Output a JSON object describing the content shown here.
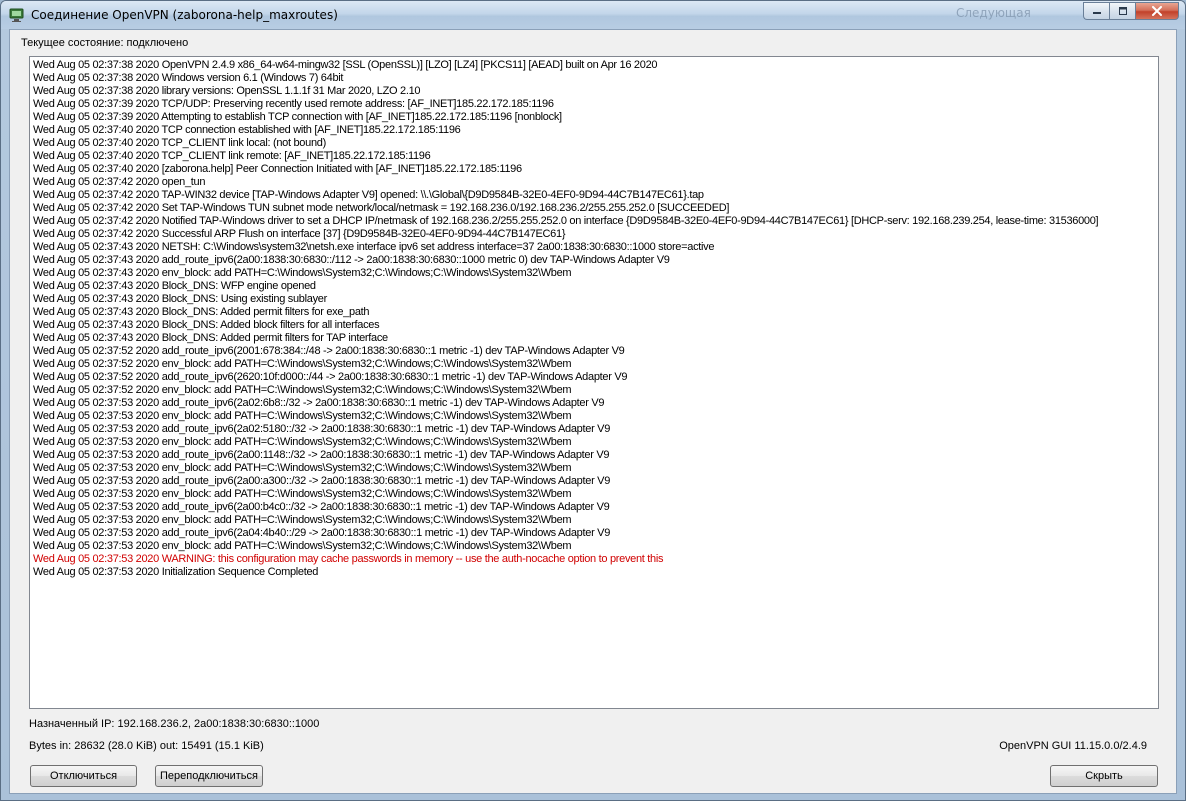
{
  "window": {
    "title": "Соединение OpenVPN (zaborona-help_maxroutes)",
    "background_text": "Следующая"
  },
  "status": {
    "label": "Текущее состояние: подключено"
  },
  "log": [
    {
      "text": "Wed Aug 05 02:37:38 2020 OpenVPN 2.4.9 x86_64-w64-mingw32 [SSL (OpenSSL)] [LZO] [LZ4] [PKCS11] [AEAD] built on Apr 16 2020",
      "warning": false
    },
    {
      "text": "Wed Aug 05 02:37:38 2020 Windows version 6.1 (Windows 7) 64bit",
      "warning": false
    },
    {
      "text": "Wed Aug 05 02:37:38 2020 library versions: OpenSSL 1.1.1f  31 Mar 2020, LZO 2.10",
      "warning": false
    },
    {
      "text": "Wed Aug 05 02:37:39 2020 TCP/UDP: Preserving recently used remote address: [AF_INET]185.22.172.185:1196",
      "warning": false
    },
    {
      "text": "Wed Aug 05 02:37:39 2020 Attempting to establish TCP connection with [AF_INET]185.22.172.185:1196 [nonblock]",
      "warning": false
    },
    {
      "text": "Wed Aug 05 02:37:40 2020 TCP connection established with [AF_INET]185.22.172.185:1196",
      "warning": false
    },
    {
      "text": "Wed Aug 05 02:37:40 2020 TCP_CLIENT link local: (not bound)",
      "warning": false
    },
    {
      "text": "Wed Aug 05 02:37:40 2020 TCP_CLIENT link remote: [AF_INET]185.22.172.185:1196",
      "warning": false
    },
    {
      "text": "Wed Aug 05 02:37:40 2020 [zaborona.help] Peer Connection Initiated with [AF_INET]185.22.172.185:1196",
      "warning": false
    },
    {
      "text": "Wed Aug 05 02:37:42 2020 open_tun",
      "warning": false
    },
    {
      "text": "Wed Aug 05 02:37:42 2020 TAP-WIN32 device [TAP-Windows Adapter V9] opened: \\\\.\\Global\\{D9D9584B-32E0-4EF0-9D94-44C7B147EC61}.tap",
      "warning": false
    },
    {
      "text": "Wed Aug 05 02:37:42 2020 Set TAP-Windows TUN subnet mode network/local/netmask = 192.168.236.0/192.168.236.2/255.255.252.0 [SUCCEEDED]",
      "warning": false
    },
    {
      "text": "Wed Aug 05 02:37:42 2020 Notified TAP-Windows driver to set a DHCP IP/netmask of 192.168.236.2/255.255.252.0 on interface {D9D9584B-32E0-4EF0-9D94-44C7B147EC61} [DHCP-serv: 192.168.239.254, lease-time: 31536000]",
      "warning": false
    },
    {
      "text": "Wed Aug 05 02:37:42 2020 Successful ARP Flush on interface [37] {D9D9584B-32E0-4EF0-9D94-44C7B147EC61}",
      "warning": false
    },
    {
      "text": "Wed Aug 05 02:37:43 2020 NETSH: C:\\Windows\\system32\\netsh.exe interface ipv6 set address interface=37 2a00:1838:30:6830::1000 store=active",
      "warning": false
    },
    {
      "text": "Wed Aug 05 02:37:43 2020 add_route_ipv6(2a00:1838:30:6830::/112 -> 2a00:1838:30:6830::1000 metric 0) dev TAP-Windows Adapter V9",
      "warning": false
    },
    {
      "text": "Wed Aug 05 02:37:43 2020 env_block: add PATH=C:\\Windows\\System32;C:\\Windows;C:\\Windows\\System32\\Wbem",
      "warning": false
    },
    {
      "text": "Wed Aug 05 02:37:43 2020 Block_DNS: WFP engine opened",
      "warning": false
    },
    {
      "text": "Wed Aug 05 02:37:43 2020 Block_DNS: Using existing sublayer",
      "warning": false
    },
    {
      "text": "Wed Aug 05 02:37:43 2020 Block_DNS: Added permit filters for exe_path",
      "warning": false
    },
    {
      "text": "Wed Aug 05 02:37:43 2020 Block_DNS: Added block filters for all interfaces",
      "warning": false
    },
    {
      "text": "Wed Aug 05 02:37:43 2020 Block_DNS: Added permit filters for TAP interface",
      "warning": false
    },
    {
      "text": "Wed Aug 05 02:37:52 2020 add_route_ipv6(2001:678:384::/48 -> 2a00:1838:30:6830::1 metric -1) dev TAP-Windows Adapter V9",
      "warning": false
    },
    {
      "text": "Wed Aug 05 02:37:52 2020 env_block: add PATH=C:\\Windows\\System32;C:\\Windows;C:\\Windows\\System32\\Wbem",
      "warning": false
    },
    {
      "text": "Wed Aug 05 02:37:52 2020 add_route_ipv6(2620:10f:d000::/44 -> 2a00:1838:30:6830::1 metric -1) dev TAP-Windows Adapter V9",
      "warning": false
    },
    {
      "text": "Wed Aug 05 02:37:52 2020 env_block: add PATH=C:\\Windows\\System32;C:\\Windows;C:\\Windows\\System32\\Wbem",
      "warning": false
    },
    {
      "text": "Wed Aug 05 02:37:53 2020 add_route_ipv6(2a02:6b8::/32 -> 2a00:1838:30:6830::1 metric -1) dev TAP-Windows Adapter V9",
      "warning": false
    },
    {
      "text": "Wed Aug 05 02:37:53 2020 env_block: add PATH=C:\\Windows\\System32;C:\\Windows;C:\\Windows\\System32\\Wbem",
      "warning": false
    },
    {
      "text": "Wed Aug 05 02:37:53 2020 add_route_ipv6(2a02:5180::/32 -> 2a00:1838:30:6830::1 metric -1) dev TAP-Windows Adapter V9",
      "warning": false
    },
    {
      "text": "Wed Aug 05 02:37:53 2020 env_block: add PATH=C:\\Windows\\System32;C:\\Windows;C:\\Windows\\System32\\Wbem",
      "warning": false
    },
    {
      "text": "Wed Aug 05 02:37:53 2020 add_route_ipv6(2a00:1148::/32 -> 2a00:1838:30:6830::1 metric -1) dev TAP-Windows Adapter V9",
      "warning": false
    },
    {
      "text": "Wed Aug 05 02:37:53 2020 env_block: add PATH=C:\\Windows\\System32;C:\\Windows;C:\\Windows\\System32\\Wbem",
      "warning": false
    },
    {
      "text": "Wed Aug 05 02:37:53 2020 add_route_ipv6(2a00:a300::/32 -> 2a00:1838:30:6830::1 metric -1) dev TAP-Windows Adapter V9",
      "warning": false
    },
    {
      "text": "Wed Aug 05 02:37:53 2020 env_block: add PATH=C:\\Windows\\System32;C:\\Windows;C:\\Windows\\System32\\Wbem",
      "warning": false
    },
    {
      "text": "Wed Aug 05 02:37:53 2020 add_route_ipv6(2a00:b4c0::/32 -> 2a00:1838:30:6830::1 metric -1) dev TAP-Windows Adapter V9",
      "warning": false
    },
    {
      "text": "Wed Aug 05 02:37:53 2020 env_block: add PATH=C:\\Windows\\System32;C:\\Windows;C:\\Windows\\System32\\Wbem",
      "warning": false
    },
    {
      "text": "Wed Aug 05 02:37:53 2020 add_route_ipv6(2a04:4b40::/29 -> 2a00:1838:30:6830::1 metric -1) dev TAP-Windows Adapter V9",
      "warning": false
    },
    {
      "text": "Wed Aug 05 02:37:53 2020 env_block: add PATH=C:\\Windows\\System32;C:\\Windows;C:\\Windows\\System32\\Wbem",
      "warning": false
    },
    {
      "text": "Wed Aug 05 02:37:53 2020 WARNING: this configuration may cache passwords in memory -- use the auth-nocache option to prevent this",
      "warning": true
    },
    {
      "text": "Wed Aug 05 02:37:53 2020 Initialization Sequence Completed",
      "warning": false
    }
  ],
  "info": {
    "assigned_ip": "Назначенный IP: 192.168.236.2, 2a00:1838:30:6830::1000",
    "bytes": "Bytes in: 28632 (28.0 KiB)  out: 15491 (15.1 KiB)",
    "version": "OpenVPN GUI 11.15.0.0/2.4.9"
  },
  "buttons": {
    "disconnect": "Отключиться",
    "reconnect": "Переподключиться",
    "hide": "Скрыть"
  },
  "colors": {
    "warning_text": "#d00000",
    "close_button": "#c2412a"
  }
}
